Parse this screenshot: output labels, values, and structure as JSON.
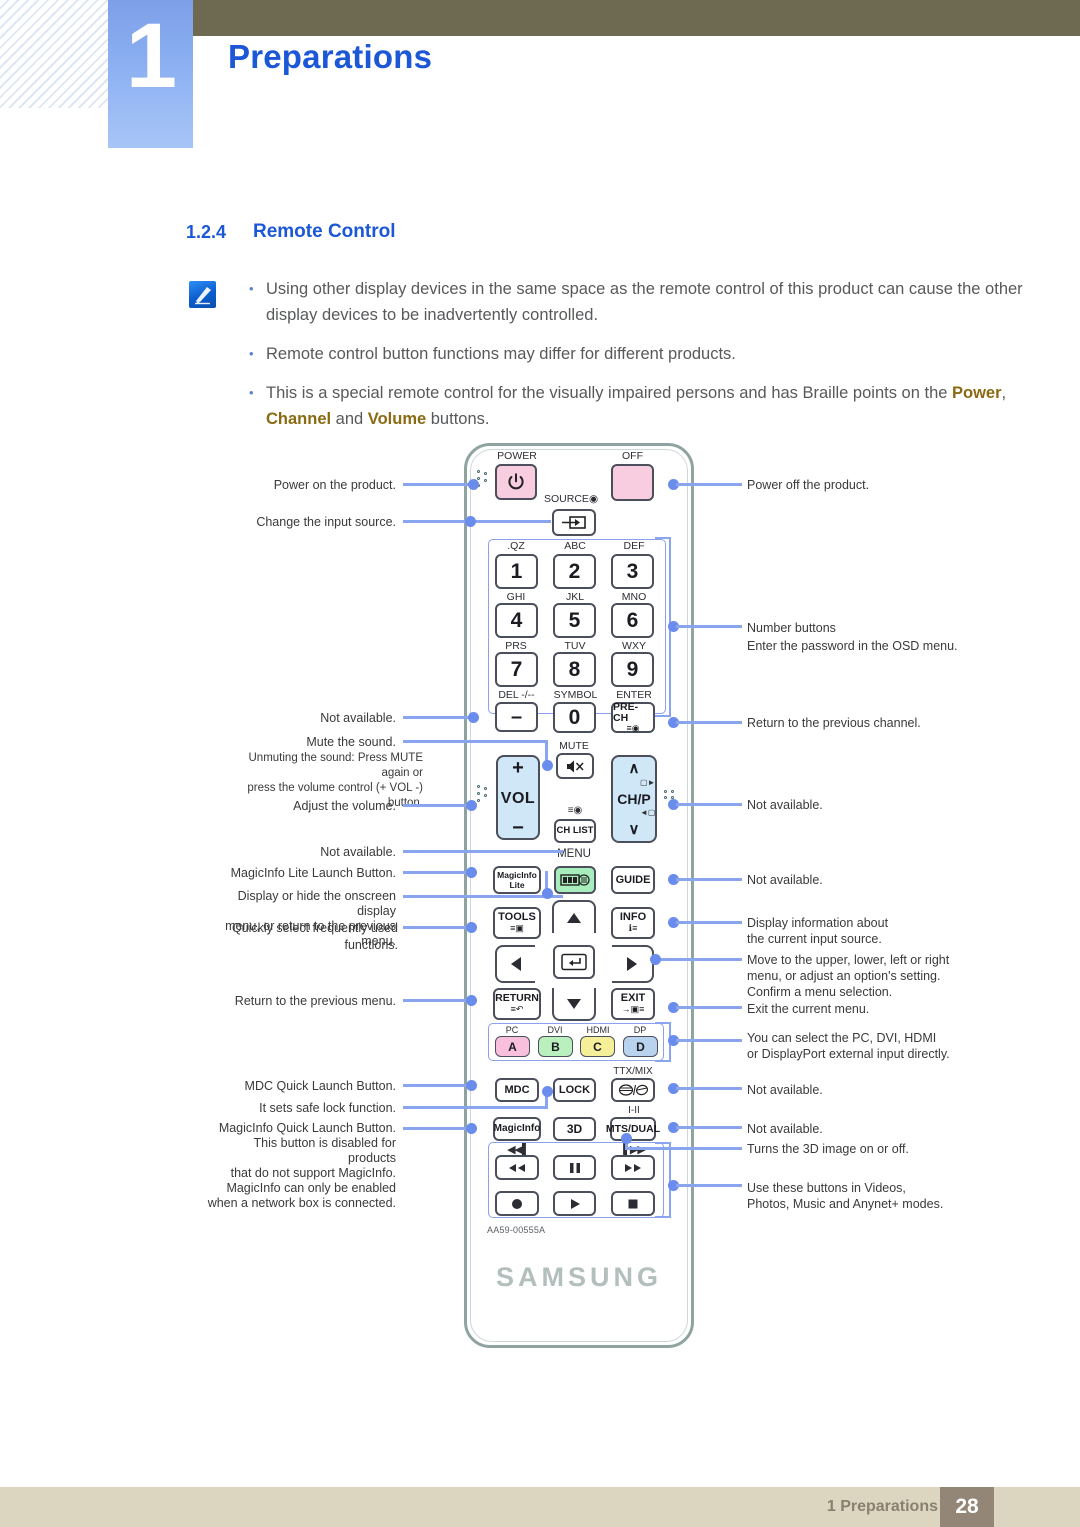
{
  "header": {
    "chapter_number": "1",
    "chapter_title": "Preparations"
  },
  "section": {
    "number": "1.2.4",
    "title": "Remote Control"
  },
  "note": {
    "icon": "note-pen-icon",
    "bullets": [
      {
        "text": "Using other display devices in the same space as the remote control of this product can cause the other display devices to be inadvertently controlled.",
        "marker": "•"
      },
      {
        "text": "Remote control button functions may differ for different products.",
        "marker": "•"
      },
      {
        "text_parts": [
          {
            "t": "This is a special remote control for the visually impaired persons and has Braille points on the ",
            "bold": false
          },
          {
            "t": "Power",
            "bold": true
          },
          {
            "t": ", ",
            "bold": false
          },
          {
            "t": "Channel",
            "bold": true
          },
          {
            "t": " and ",
            "bold": false
          },
          {
            "t": "Volume",
            "bold": true
          },
          {
            "t": " buttons.",
            "bold": false
          }
        ],
        "marker": "•"
      }
    ]
  },
  "remote": {
    "brand": "SAMSUNG",
    "model_code": "AA59-00555A",
    "labels": {
      "power": "POWER",
      "off": "OFF",
      "source": "SOURCE",
      "key1_top": ".QZ",
      "key2_top": "ABC",
      "key3_top": "DEF",
      "key4_top": "GHI",
      "key5_top": "JKL",
      "key6_top": "MNO",
      "key7_top": "PRS",
      "key8_top": "TUV",
      "key9_top": "WXY",
      "del_top": "DEL -/--",
      "symbol_top": "SYMBOL",
      "enter_top": "ENTER",
      "mute_top": "MUTE",
      "menu_top": "MENU",
      "ttxmix_top": "TTX/MIX",
      "iii_top": "I-II"
    },
    "keys": {
      "n1": "1",
      "n2": "2",
      "n3": "3",
      "n4": "4",
      "n5": "5",
      "n6": "6",
      "n7": "7",
      "n8": "8",
      "n9": "9",
      "n0": "0",
      "dash": "–",
      "prech": "PRE-CH",
      "vol": "VOL",
      "chp": "CH/P",
      "chlist": "CH LIST",
      "magicinfo_lite": "MagicInfo\nLite",
      "guide": "GUIDE",
      "tools": "TOOLS",
      "info": "INFO",
      "return": "RETURN",
      "exit": "EXIT",
      "sw_a": "A",
      "sw_b": "B",
      "sw_c": "C",
      "sw_d": "D",
      "sw_a_top": "PC",
      "sw_b_top": "DVI",
      "sw_c_top": "HDMI",
      "sw_d_top": "DP",
      "mdc": "MDC",
      "lock": "LOCK",
      "magicinfo": "MagicInfo",
      "threed": "3D",
      "mtsdual": "MTS/DUAL"
    },
    "colors": {
      "power_pink": "#f9cde0",
      "vol_blue": "#cfe7f7",
      "menu_green": "#a8eebc",
      "sw_a": "#f8c0dc",
      "sw_b": "#b9f0bd",
      "sw_c": "#f5ef9a",
      "sw_d": "#b9d3ee",
      "body_border": "#8fa3a0",
      "callout": "#8aa5ef"
    }
  },
  "callouts": {
    "left": [
      "Power on the product.",
      "Change the input source.",
      "Not available.",
      "Mute the sound.",
      "Unmuting the sound: Press MUTE again or\npress the volume control (+  VOL  -) button.",
      "Adjust the volume.",
      "Not available.",
      "MagicInfo Lite Launch Button.",
      "Display or hide the onscreen display\nmenu, or return to the previous menu.",
      "Quickly select frequently used functions.",
      "Return to the previous menu.",
      "MDC Quick Launch Button.",
      "It sets safe lock function.",
      "MagicInfo Quick Launch Button.\nThis button is disabled for products\nthat do not support MagicInfo.\nMagicInfo can only be enabled\nwhen a network box is connected."
    ],
    "right": [
      "Power off the product.",
      "Number buttons\nEnter the password in the OSD menu.",
      "Return to the previous channel.",
      "Not available.",
      "Not available.",
      "Display information about\nthe current input source.",
      "Move to the upper, lower, left or right\nmenu, or adjust an option's setting.\nConfirm a menu selection.",
      "Exit the current menu.",
      "You can select the PC, DVI, HDMI\nor DisplayPort external input directly.",
      "Not available.",
      "Not available.",
      "Turns the 3D image on or off.",
      "Use these buttons in Videos,\nPhotos, Music and Anynet+ modes."
    ]
  },
  "footer": {
    "chapter": "1 Preparations",
    "page": "28"
  }
}
